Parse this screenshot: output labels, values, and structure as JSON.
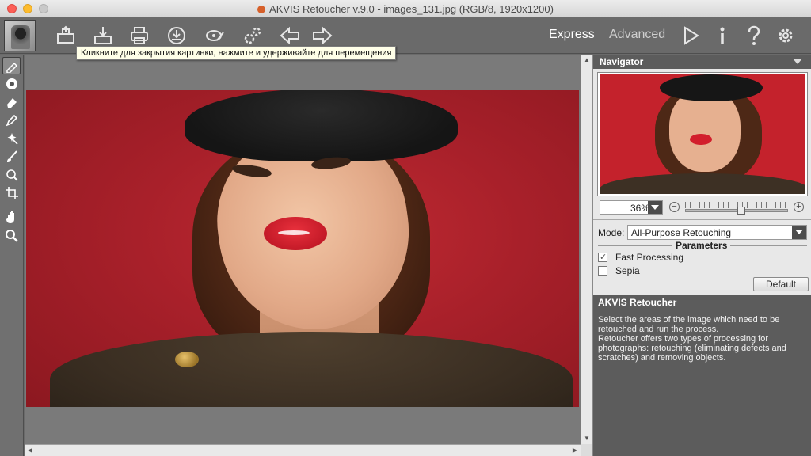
{
  "window": {
    "title": "AKVIS Retoucher v.9.0 - images_131.jpg (RGB/8, 1920x1200)"
  },
  "toolbar": {
    "buttons": [
      {
        "name": "open-image-button",
        "icon": "open-icon"
      },
      {
        "name": "save-image-button",
        "icon": "save-icon"
      },
      {
        "name": "print-button",
        "icon": "print-icon"
      },
      {
        "name": "share-button",
        "icon": "share-icon"
      },
      {
        "name": "batch-button",
        "icon": "batch-icon"
      },
      {
        "name": "preferences-gears-button",
        "icon": "gears-icon"
      },
      {
        "name": "undo-button",
        "icon": "arrow-left-icon"
      },
      {
        "name": "redo-button",
        "icon": "arrow-right-icon"
      }
    ],
    "express_label": "Express",
    "advanced_label": "Advanced",
    "tooltip": "Кликните для закрытия картинки, нажмите и удерживайте для перемещения"
  },
  "tools": [
    {
      "name": "tool-selection",
      "icon": "selection-brush-icon"
    },
    {
      "name": "tool-stamp",
      "icon": "stamp-icon"
    },
    {
      "name": "tool-eraser",
      "icon": "eraser-icon"
    },
    {
      "name": "tool-pencil",
      "icon": "pencil-icon"
    },
    {
      "name": "tool-magic-wand",
      "icon": "magic-wand-icon"
    },
    {
      "name": "tool-brush",
      "icon": "brush-icon"
    },
    {
      "name": "tool-healing",
      "icon": "healing-icon"
    },
    {
      "name": "tool-crop",
      "icon": "crop-icon"
    },
    {
      "name": "tool-hand",
      "icon": "hand-icon"
    },
    {
      "name": "tool-zoom",
      "icon": "zoom-icon"
    }
  ],
  "navigator": {
    "title": "Navigator",
    "zoom_value": "36%",
    "zoom_min_symbol": "−",
    "zoom_max_symbol": "+",
    "zoom_level": 0.55
  },
  "settings": {
    "mode_label": "Mode:",
    "mode_value": "All-Purpose Retouching",
    "parameters_title": "Parameters",
    "fast_processing_label": "Fast Processing",
    "fast_processing_checked": true,
    "sepia_label": "Sepia",
    "sepia_checked": false,
    "default_button": "Default"
  },
  "help": {
    "title": "AKVIS Retoucher",
    "paragraph1": "Select the areas of the image which need to be retouched and run the process.",
    "paragraph2": "Retoucher offers two types of processing for photographs: retouching (eliminating defects and scratches) and removing objects."
  },
  "colors": {
    "titlebar": "#dcdcdc",
    "toolbar": "#6a6a6a",
    "panel": "#e8e8e8",
    "photo_background": "#b02530"
  }
}
